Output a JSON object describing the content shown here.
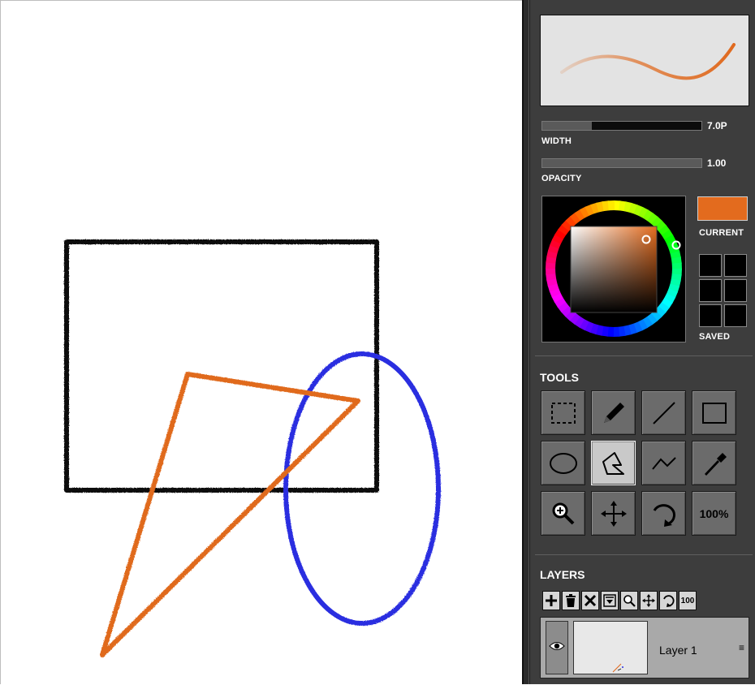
{
  "canvas": {
    "shapes": [
      {
        "name": "black-rectangle",
        "color": "#111111"
      },
      {
        "name": "orange-triangle",
        "color": "#e06a1f"
      },
      {
        "name": "blue-ellipse",
        "color": "#2a2ee0"
      }
    ]
  },
  "brush": {
    "width_value": "7.0P",
    "width_label": "WIDTH",
    "width_fill": 0.31,
    "opacity_value": "1.00",
    "opacity_label": "OPACITY",
    "opacity_fill": 1.0,
    "stroke_color": "#e06a1f"
  },
  "color": {
    "current_label": "CURRENT",
    "saved_label": "SAVED",
    "current_color": "#e36b1e",
    "saved_colors": [
      "#000000",
      "#000000",
      "#000000",
      "#000000",
      "#000000",
      "#000000"
    ]
  },
  "tools": {
    "title": "TOOLS",
    "items": [
      {
        "name": "select-tool",
        "icon": "dashed-square-icon"
      },
      {
        "name": "pencil-tool",
        "icon": "pencil-icon"
      },
      {
        "name": "line-tool",
        "icon": "line-icon"
      },
      {
        "name": "rectangle-tool",
        "icon": "rectangle-icon"
      },
      {
        "name": "ellipse-tool",
        "icon": "ellipse-icon"
      },
      {
        "name": "polygon-tool",
        "icon": "polygon-icon",
        "active": true
      },
      {
        "name": "polyline-tool",
        "icon": "polyline-icon"
      },
      {
        "name": "eyedropper-tool",
        "icon": "eyedropper-icon"
      },
      {
        "name": "zoom-tool",
        "icon": "zoom-icon"
      },
      {
        "name": "move-tool",
        "icon": "move-icon"
      },
      {
        "name": "rotate-tool",
        "icon": "rotate-icon"
      },
      {
        "name": "actual-size-tool",
        "label": "100%"
      }
    ]
  },
  "layers": {
    "title": "LAYERS",
    "toolbar": [
      {
        "name": "add-layer",
        "icon": "plus-icon"
      },
      {
        "name": "delete-layer",
        "icon": "trash-icon"
      },
      {
        "name": "clear-layer",
        "icon": "x-icon"
      },
      {
        "name": "merge-layer",
        "icon": "merge-down-icon"
      },
      {
        "name": "zoom-layer",
        "icon": "zoom-icon"
      },
      {
        "name": "move-layer",
        "icon": "move-icon"
      },
      {
        "name": "rotate-layer",
        "icon": "rotate-icon"
      },
      {
        "name": "actual-size-layer",
        "label": "100"
      }
    ],
    "items": [
      {
        "name": "Layer 1",
        "visible": true
      }
    ]
  }
}
